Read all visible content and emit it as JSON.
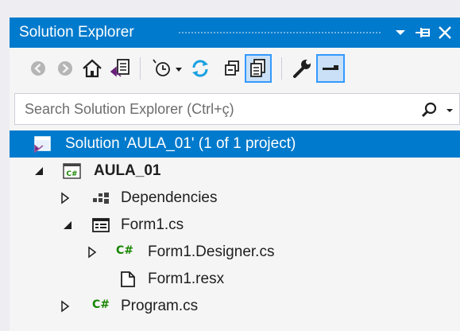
{
  "window": {
    "title": "Solution Explorer"
  },
  "search": {
    "placeholder": "Search Solution Explorer (Ctrl+ç)"
  },
  "toolbar": {
    "icons": [
      "back-icon",
      "forward-icon",
      "home-icon",
      "switch-views-icon",
      "pending-changes-filter-icon",
      "refresh-icon",
      "collapse-all-icon",
      "show-all-files-icon",
      "properties-icon",
      "preview-selected-icon"
    ]
  },
  "tree": {
    "solution": "Solution 'AULA_01' (1 of 1 project)",
    "project": "AULA_01",
    "project_badge": "C#",
    "dependencies": "Dependencies",
    "form1": "Form1.cs",
    "form1_designer": "Form1.Designer.cs",
    "form1_resx": "Form1.resx",
    "program": "Program.cs",
    "cs_badge": "C#"
  },
  "colors": {
    "accent": "#007acc",
    "csharp_green": "#178600",
    "selection": "#007acc"
  }
}
